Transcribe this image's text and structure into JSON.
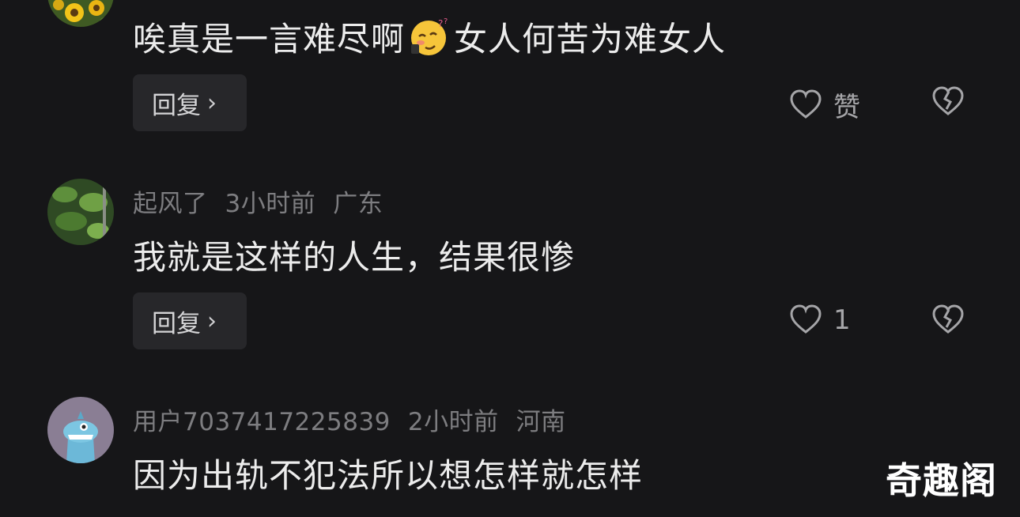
{
  "comments": [
    {
      "user": "",
      "time": "",
      "location": "",
      "text_before": "唉真是一言难尽啊",
      "emoji": "drunk-face-emoji",
      "text_after": "女人何苦为难女人",
      "reply_label": "回复",
      "like_label": "赞",
      "avatar": "sunflower-avatar"
    },
    {
      "user": "起风了",
      "time": "3小时前",
      "location": "广东",
      "text": "我就是这样的人生，结果很惨",
      "reply_label": "回复",
      "like_label": "1",
      "avatar": "green-plant-avatar"
    },
    {
      "user": "用户7037417225839",
      "time": "2小时前",
      "location": "河南",
      "text": "因为出轨不犯法所以想怎样就怎样",
      "avatar": "blue-monster-avatar"
    }
  ],
  "icons": {
    "reply_chevron": "›"
  },
  "watermark": "奇趣阁",
  "colors": {
    "background": "#161618",
    "text": "#ececec",
    "meta": "#7d7d80",
    "button": "#27272a"
  }
}
